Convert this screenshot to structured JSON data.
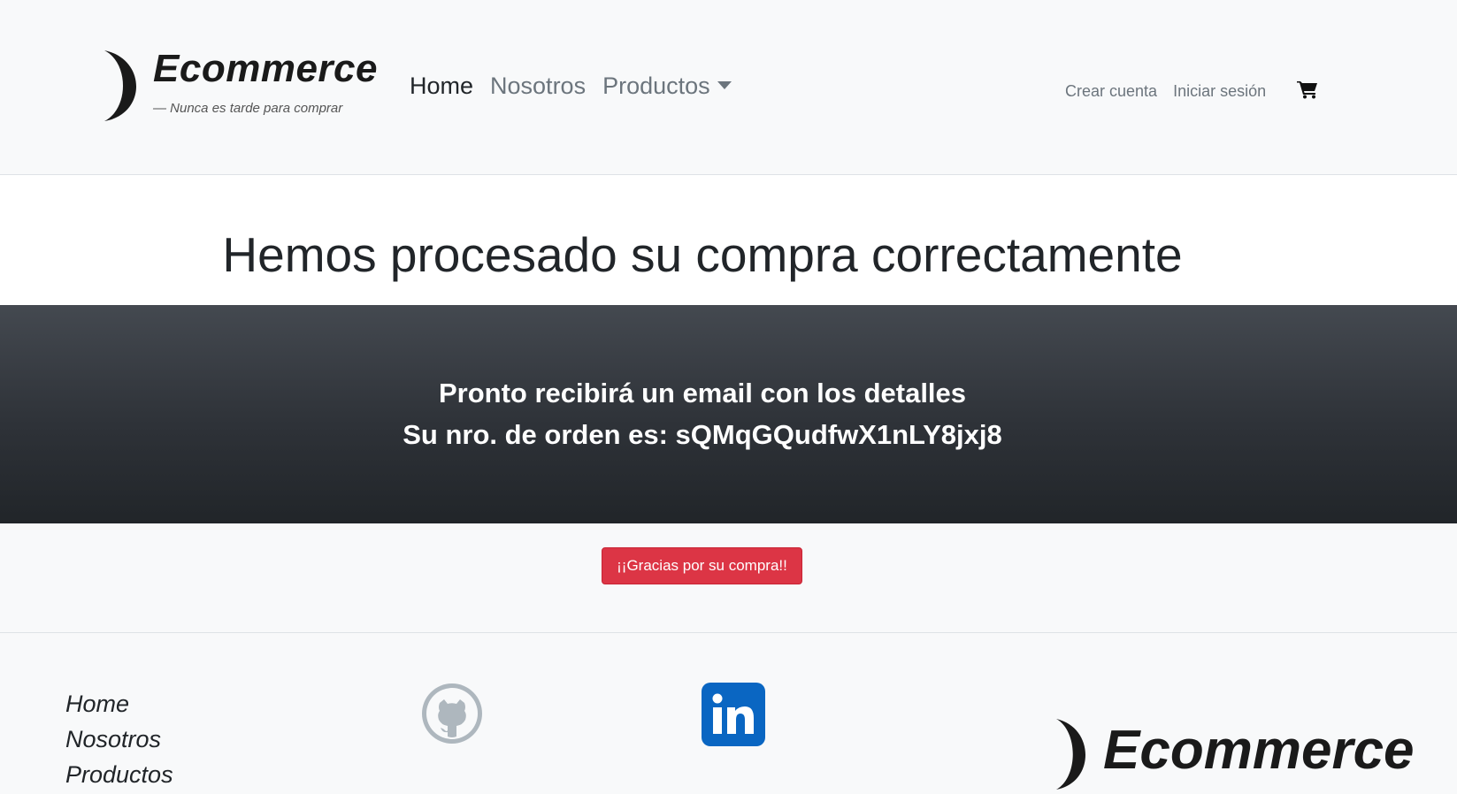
{
  "header": {
    "brand": {
      "name": "Ecommerce",
      "tagline": "— Nunca es tarde para comprar",
      "logo_icon": "crescent-moon-icon"
    },
    "nav": {
      "home": "Home",
      "about": "Nosotros",
      "products": "Productos"
    },
    "account": {
      "create": "Crear cuenta",
      "login": "Iniciar sesión"
    },
    "cart_icon": "cart-icon"
  },
  "main": {
    "title": "Hemos procesado su compra correctamente",
    "banner": {
      "line1": "Pronto recibirá un email con los detalles",
      "line2": "Su nro. de orden es: sQMqGQudfwX1nLY8jxj8"
    },
    "thanks_button": "¡¡Gracias por su compra!!"
  },
  "footer": {
    "links": {
      "home": "Home",
      "about": "Nosotros",
      "products": "Productos"
    },
    "social": {
      "github_icon": "github-icon",
      "linkedin_icon": "linkedin-icon"
    },
    "brand": {
      "name": "Ecommerce"
    }
  },
  "colors": {
    "background": "#f8f9fa",
    "banner_dark": "#212529",
    "accent_red": "#dc3545",
    "linkedin_blue": "#0a66c2",
    "github_gray": "#aeb7be"
  }
}
